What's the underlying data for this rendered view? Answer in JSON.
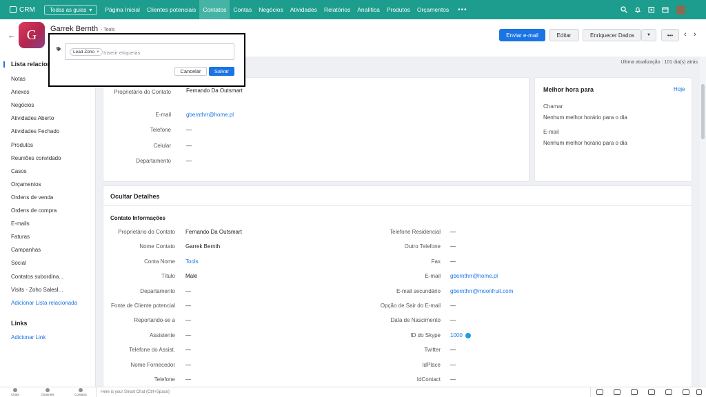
{
  "topbar": {
    "app_name": "CRM",
    "gallery_label": "Todas as guias",
    "nav": [
      "Página Inicial",
      "Clientes potenciais",
      "Contatos",
      "Contas",
      "Negócios",
      "Atividades",
      "Relatórios",
      "Analítica",
      "Produtos",
      "Orçamentos"
    ],
    "active_nav": "Contatos",
    "more": "•••",
    "accent_color": "#1c9d8d",
    "icons": [
      "search-icon",
      "bell-icon",
      "add-record-icon",
      "calendar-icon",
      "settings-icon"
    ]
  },
  "record": {
    "avatar_letter": "G",
    "name": "Garrek Bernth",
    "account": "- Tools",
    "buttons": {
      "send_email": "Enviar e-mail",
      "edit": "Editar",
      "enrich": "Enriquecer Dados",
      "more": "•••"
    },
    "last_update": "Última atualização : 101 dia(s) atrás"
  },
  "tag_popup": {
    "chip": "Lead Zoho",
    "chip_close": "×",
    "placeholder": "Inserir etiquetas",
    "cancel": "Cancelar",
    "save": "Salvar"
  },
  "sidebar": {
    "title": "Lista relacionada",
    "items": [
      "Notas",
      "Anexos",
      "Negócios",
      "Atividades Aberto",
      "Atividades Fechado",
      "Produtos",
      "Reuniões convidado",
      "Casos",
      "Orçamentos",
      "Ordens de venda",
      "Ordens de compra",
      "E-mails",
      "Faturas",
      "Campanhas",
      "Social",
      "Contatos subordina...",
      "Visits - Zoho SalesI..."
    ],
    "add_related": "Adicionar Lista relacionada",
    "links_title": "Links",
    "add_link": "Adicionar Link"
  },
  "summary": {
    "fields": [
      {
        "label": "Proprietário do Contato",
        "value": "Fernando Da Outsmart"
      },
      {
        "label": "E-mail",
        "value": "gbernthrr@home.pl"
      },
      {
        "label": "Telefone",
        "value": "—"
      },
      {
        "label": "Celular",
        "value": "—"
      },
      {
        "label": "Departamento",
        "value": "—"
      }
    ]
  },
  "best_time": {
    "title": "Melhor hora para",
    "today": "Hoje",
    "call_label": "Chamar",
    "call_value": "Nenhum melhor horário para o dia",
    "email_label": "E-mail",
    "email_value": "Nenhum melhor horário para o dia"
  },
  "details": {
    "toggle": "Ocultar Detalhes",
    "section": "Contato Informações",
    "left": [
      {
        "label": "Proprietário do Contato",
        "value": "Fernando Da Outsmart"
      },
      {
        "label": "Nome Contato",
        "value": "Garrek Bernth"
      },
      {
        "label": "Conta Nome",
        "value": "Tools"
      },
      {
        "label": "Título",
        "value": "Male"
      },
      {
        "label": "Departamento",
        "value": "—"
      },
      {
        "label": "Fonte de Cliente potencial",
        "value": "—"
      },
      {
        "label": "Reportando-se a",
        "value": "—"
      },
      {
        "label": "Assistente",
        "value": "—"
      },
      {
        "label": "Telefone do Assist.",
        "value": "—"
      },
      {
        "label": "Nome Fornecedor",
        "value": "—"
      },
      {
        "label": "Telefone",
        "value": "—"
      }
    ],
    "right": [
      {
        "label": "Telefone Residencial",
        "value": "—"
      },
      {
        "label": "Outro Telefone",
        "value": "—"
      },
      {
        "label": "Fax",
        "value": "—"
      },
      {
        "label": "E-mail",
        "value": "gbernthrr@home.pl"
      },
      {
        "label": "E-mail secundário",
        "value": "gbernthrr@moonfruit.com"
      },
      {
        "label": "Opção de Sair do E-mail",
        "value": "—"
      },
      {
        "label": "Data de Nascimento",
        "value": "—"
      },
      {
        "label": "ID do Skype",
        "value": "1000"
      },
      {
        "label": "Twitter",
        "value": "—"
      },
      {
        "label": "IdPlace",
        "value": "—"
      },
      {
        "label": "IdContact",
        "value": "—"
      }
    ]
  },
  "footer": {
    "chats": "Chats",
    "channels": "Channels",
    "contacts": "Contacts",
    "smart_chat": "Here is your Smart Chat (Ctrl+Space)"
  }
}
